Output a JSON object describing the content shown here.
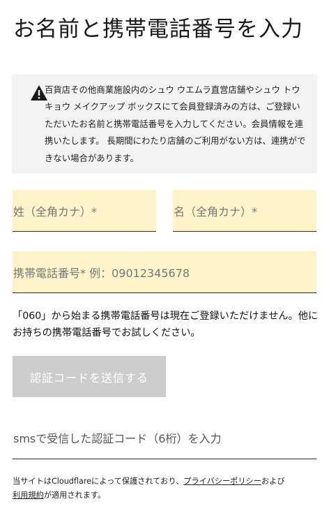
{
  "page": {
    "title": "お名前と携帯電話番号を入力"
  },
  "notice": {
    "icon": "warning-icon",
    "text": "百貨店その他商業施設内のシュウ ウエムラ直営店舗やシュウ トウキョウ メイクアップ ボックスにて会員登録済みの方は、ご登録いただいたお名前と携帯電話番号を入力してください。会員情報を連携いたします。 長期間にわたり店舗のご利用がない方は、連携ができない場合があります。"
  },
  "form": {
    "last_name_placeholder": "姓（全角カナ）*",
    "first_name_placeholder": "名（全角カナ）*",
    "phone_placeholder": "携帯電話番号* 例：09012345678",
    "phone_warning": "「060」から始まる携帯電話番号は現在ご登録いただけません。他にお持ちの携帯電話番号でお試しください。",
    "send_code_button": "認証コードを送信する",
    "code_placeholder": "smsで受信した認証コード（6桁）を入力"
  },
  "footer": {
    "text_before": "当サイトはCloudflareによって保護されており、",
    "privacy_link": "プライバシーポリシー",
    "text_middle": "および",
    "terms_link": "利用規約",
    "text_after": "が適用されます。"
  },
  "colors": {
    "field_bg": "#fff4c9",
    "button_disabled_bg": "#cdcdcd",
    "notice_bg": "#f3f3f3"
  }
}
